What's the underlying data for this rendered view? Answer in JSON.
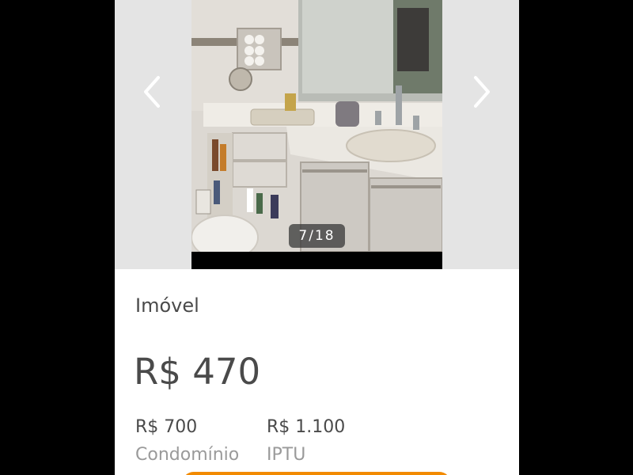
{
  "gallery": {
    "counter": "7/18",
    "prev_icon": "chevron-left-icon",
    "next_icon": "chevron-right-icon",
    "photo_subject": "bathroom-vanity-photo"
  },
  "listing": {
    "category": "Imóvel",
    "price": "R$ 470",
    "fees": [
      {
        "value": "R$ 700",
        "label": "Condomínio"
      },
      {
        "value": "R$ 1.100",
        "label": "IPTU"
      }
    ]
  },
  "colors": {
    "background": "#000000",
    "card": "#ffffff",
    "gallery_bg": "#e4e4e4",
    "text_primary": "#4a4a4a",
    "text_secondary": "#9a9a9a",
    "accent": "#f28a00"
  }
}
